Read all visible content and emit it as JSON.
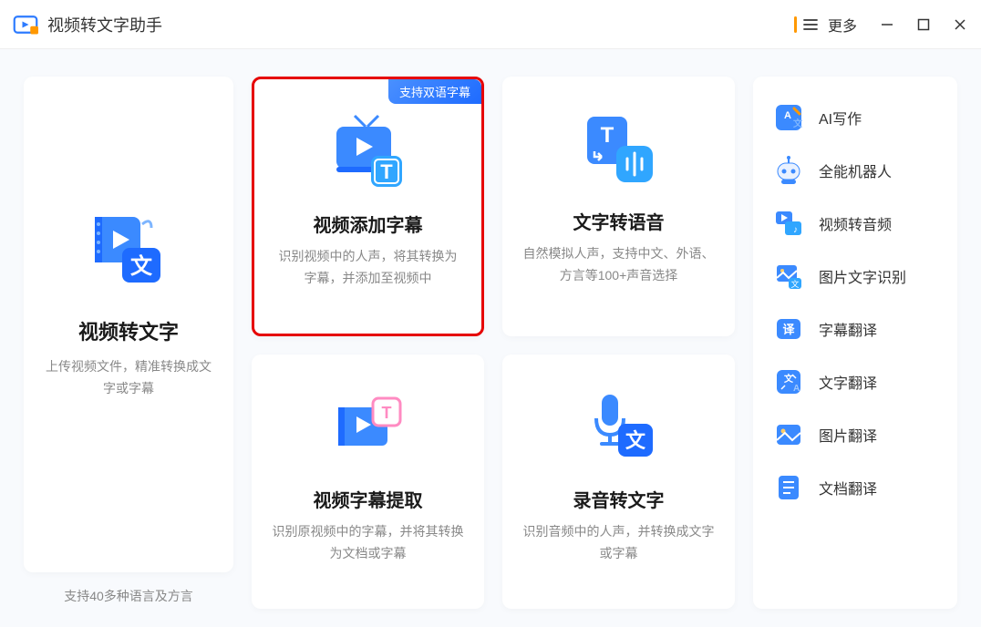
{
  "app_title": "视频转文字助手",
  "more_label": "更多",
  "main_card": {
    "title": "视频转文字",
    "desc": "上传视频文件，精准转换成文字或字幕"
  },
  "left_footer": "支持40多种语言及方言",
  "cards": [
    {
      "title": "视频添加字幕",
      "desc": "识别视频中的人声，将其转换为字幕，并添加至视频中",
      "badge": "支持双语字幕"
    },
    {
      "title": "文字转语音",
      "desc": "自然模拟人声，支持中文、外语、方言等100+声音选择"
    },
    {
      "title": "视频字幕提取",
      "desc": "识别原视频中的字幕，并将其转换为文档或字幕"
    },
    {
      "title": "录音转文字",
      "desc": "识别音频中的人声，并转换成文字或字幕"
    }
  ],
  "sidebar": [
    {
      "label": "AI写作"
    },
    {
      "label": "全能机器人"
    },
    {
      "label": "视频转音频"
    },
    {
      "label": "图片文字识别"
    },
    {
      "label": "字幕翻译"
    },
    {
      "label": "文字翻译"
    },
    {
      "label": "图片翻译"
    },
    {
      "label": "文档翻译"
    }
  ]
}
